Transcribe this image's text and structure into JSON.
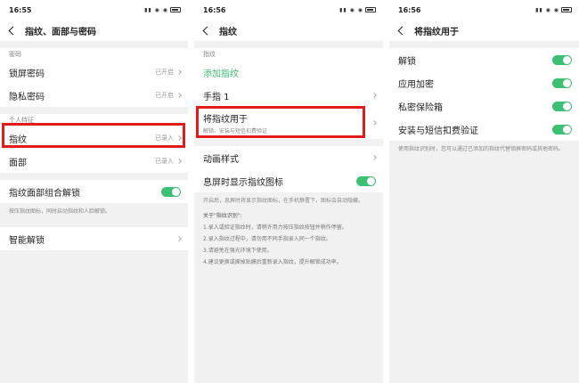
{
  "status": {
    "time1": "16:55",
    "time2": "16:56",
    "time3": "16:56",
    "icons": "▮▮ ◉ ◉"
  },
  "screen1": {
    "title": "指纹、面部与密码",
    "section_password": "密码",
    "rows_password": [
      {
        "label": "锁屏密码",
        "value": "已开启"
      },
      {
        "label": "隐私密码",
        "value": "已开启"
      }
    ],
    "section_personal": "个人特征",
    "rows_personal": [
      {
        "label": "指纹",
        "value": "已录入"
      },
      {
        "label": "面部",
        "value": "已录入"
      }
    ],
    "combo_label": "指纹面部组合解锁",
    "combo_note": "按压指纹图标，同时启动指纹和人脸解锁。",
    "smart_unlock": "智能解锁"
  },
  "screen2": {
    "title": "指纹",
    "section": "指纹",
    "add_fp": "添加指纹",
    "finger1": "手指 1",
    "use_title": "将指纹用于",
    "use_sub": "解锁、安装与短信扣费验证",
    "anim": "动画样式",
    "aod_label": "息屏时显示指纹图标",
    "aod_note": "开启后，息屏时将显示指纹图标，在手机静置下，图标会自动隐藏。",
    "tips_head": "关于\"指纹识别\":",
    "tips": [
      "1.录入或验证指纹时，请稍许用力按压指纹按钮并稍作停留。",
      "2.录入指纹过程中，请勿用不同手指录入同一个指纹。",
      "3.请避免在强光环境下使用。",
      "4.建议更换或撕掉贴膜后重新录入指纹，提升解锁成功率。"
    ]
  },
  "screen3": {
    "title": "将指纹用于",
    "rows": [
      {
        "label": "解锁"
      },
      {
        "label": "应用加密"
      },
      {
        "label": "私密保险箱"
      },
      {
        "label": "安装与短信扣费验证"
      }
    ],
    "note": "使用指纹识别时，您可以通过已添加的指纹代替锁屏密码或其他密码。"
  },
  "colors": {
    "accent": "#3dbf74",
    "highlight": "#e21b1b"
  }
}
